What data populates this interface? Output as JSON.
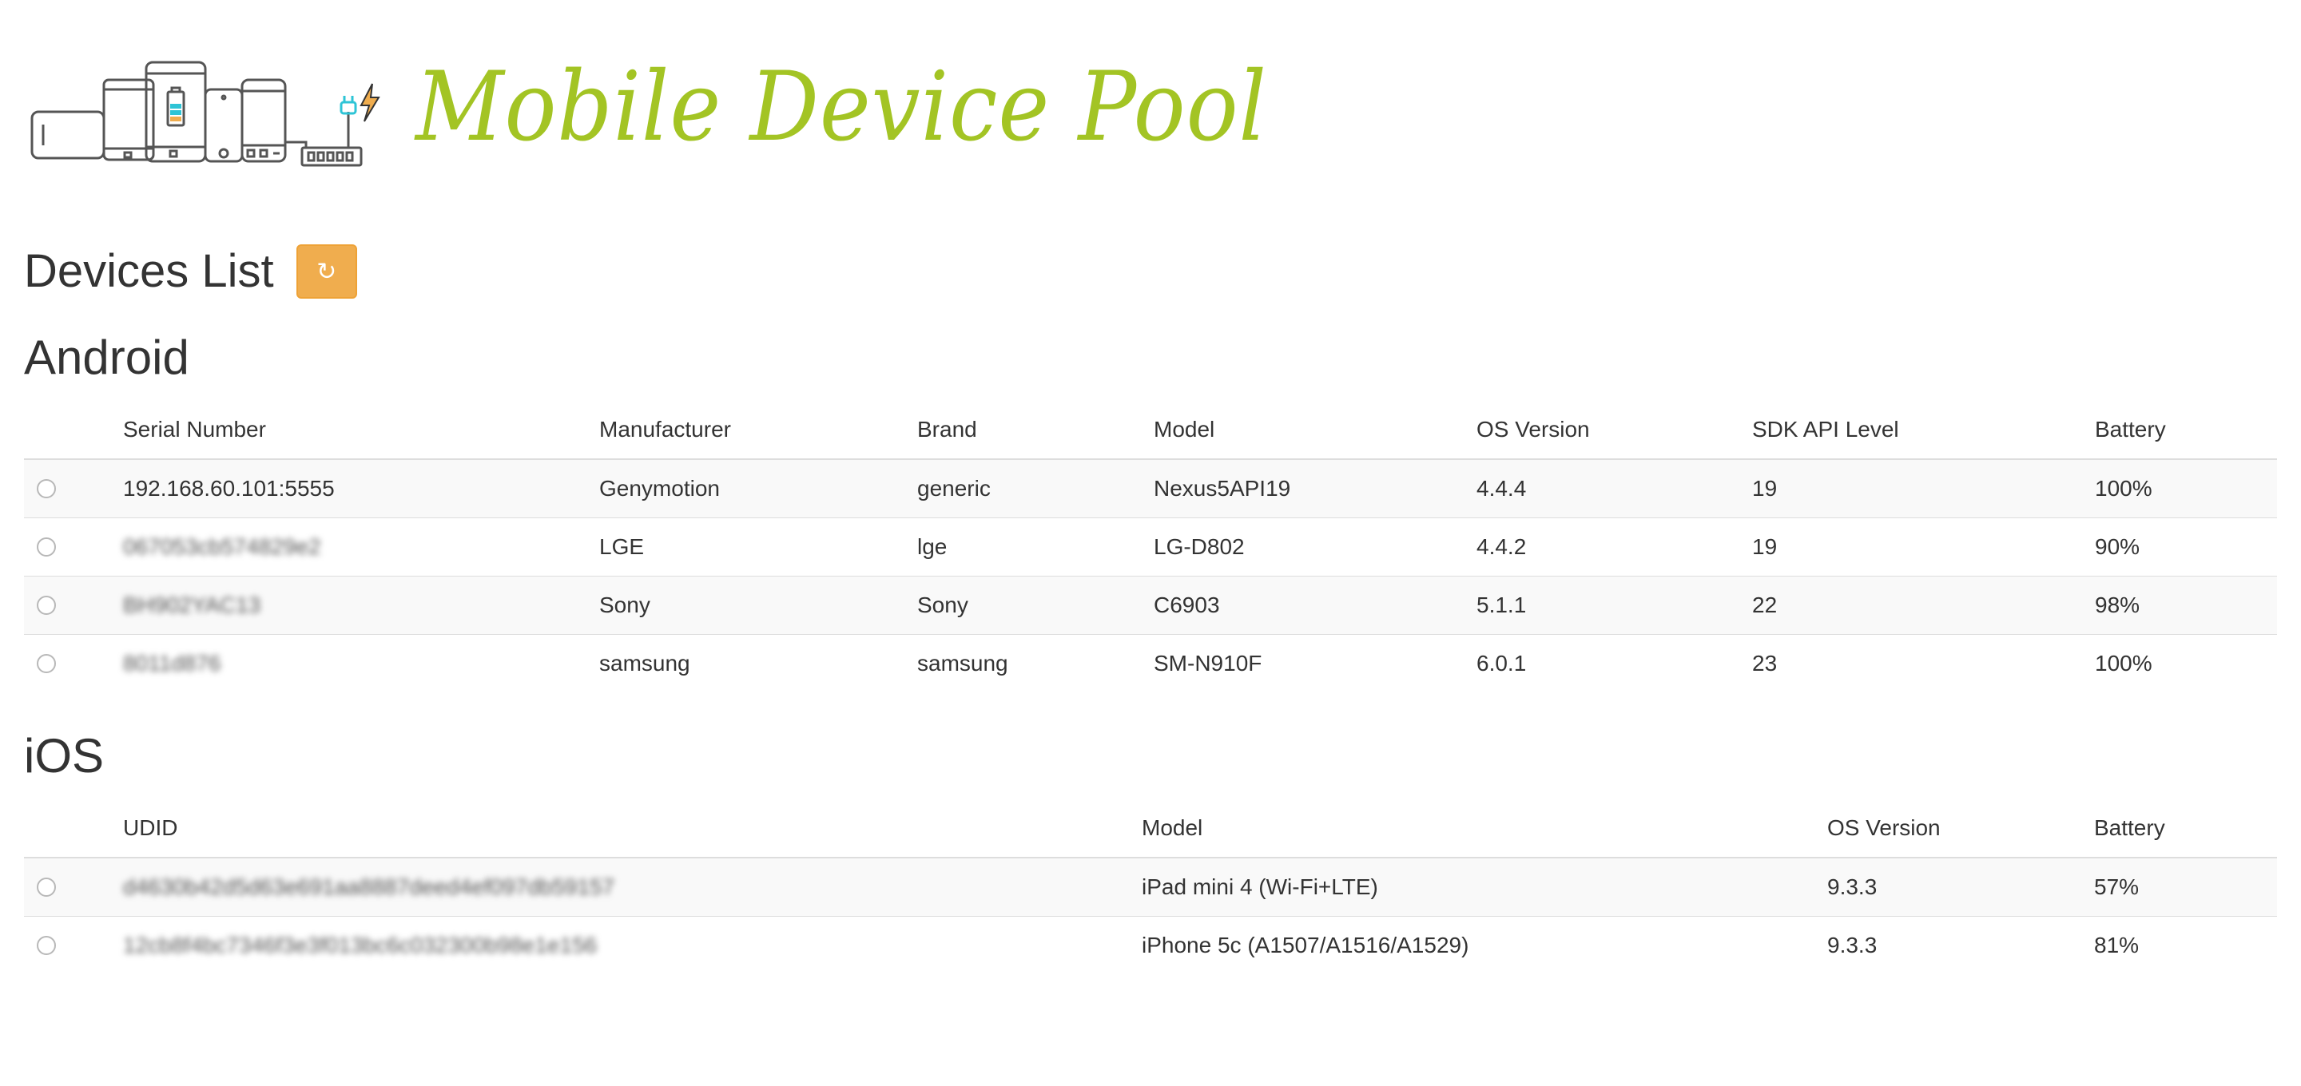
{
  "app": {
    "title": "Mobile Device Pool"
  },
  "devices_list": {
    "heading": "Devices List",
    "refresh_icon": "refresh-icon",
    "refresh_glyph": "↻",
    "refresh_color": "#f0ad4e"
  },
  "android": {
    "title": "Android",
    "columns": [
      "Serial Number",
      "Manufacturer",
      "Brand",
      "Model",
      "OS Version",
      "SDK API Level",
      "Battery"
    ],
    "rows": [
      {
        "serial": "192.168.60.101:5555",
        "manufacturer": "Genymotion",
        "brand": "generic",
        "model": "Nexus5API19",
        "os": "4.4.4",
        "sdk": "19",
        "battery": "100%"
      },
      {
        "serial": "067053cb574829e2",
        "manufacturer": "LGE",
        "brand": "lge",
        "model": "LG-D802",
        "os": "4.4.2",
        "sdk": "19",
        "battery": "90%"
      },
      {
        "serial": "BH902YAC13",
        "manufacturer": "Sony",
        "brand": "Sony",
        "model": "C6903",
        "os": "5.1.1",
        "sdk": "22",
        "battery": "98%"
      },
      {
        "serial": "8011d876",
        "manufacturer": "samsung",
        "brand": "samsung",
        "model": "SM-N910F",
        "os": "6.0.1",
        "sdk": "23",
        "battery": "100%"
      }
    ]
  },
  "ios": {
    "title": "iOS",
    "columns": [
      "UDID",
      "Model",
      "OS Version",
      "Battery"
    ],
    "rows": [
      {
        "udid": "d4630b42d5d63e691aa8887deed4ef097db59157",
        "model": "iPad mini 4 (Wi-Fi+LTE)",
        "os": "9.3.3",
        "battery": "57%"
      },
      {
        "udid": "12cb8f4bc7346f3e3f013bc6c032300b98e1e156",
        "model": "iPhone 5c (A1507/A1516/A1529)",
        "os": "9.3.3",
        "battery": "81%"
      }
    ]
  },
  "colors": {
    "title_green": "#a3c424",
    "row_stripe": "#f9f9f9",
    "border": "#dddddd"
  }
}
